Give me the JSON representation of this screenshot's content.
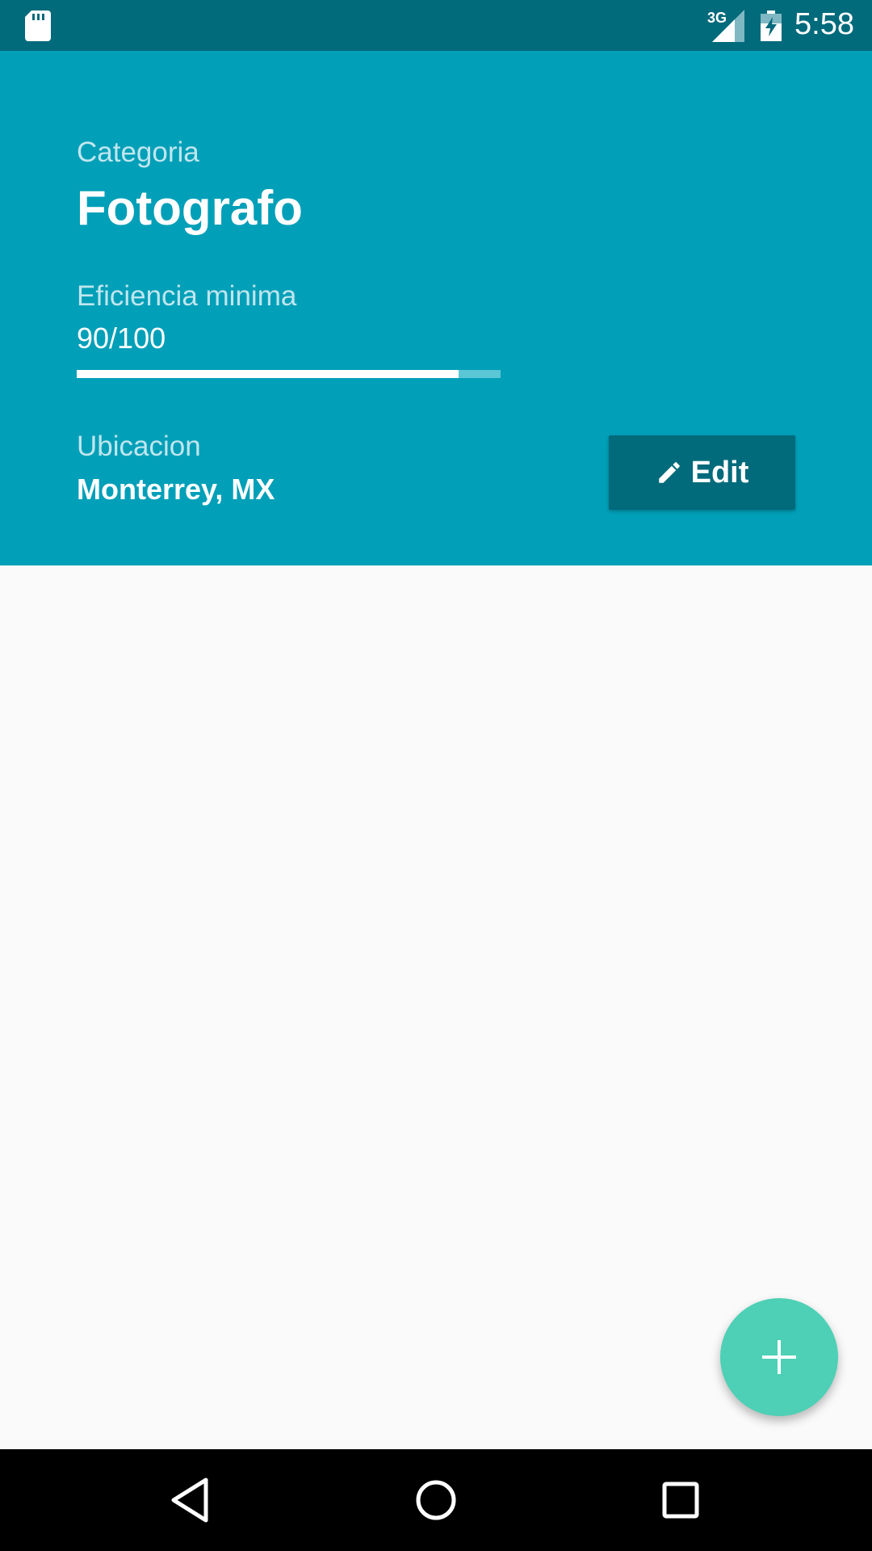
{
  "status_bar": {
    "time": "5:58",
    "network_type": "3G",
    "icons": [
      "sd-card-icon",
      "signal-icon",
      "battery-charging-icon"
    ]
  },
  "header": {
    "category_label": "Categoria",
    "category_value": "Fotografo",
    "efficiency_label": "Eficiencia minima",
    "efficiency_value": "90/100",
    "efficiency_progress": 0.9,
    "location_label": "Ubicacion",
    "location_value": "Monterrey, MX",
    "edit_button_label": "Edit",
    "edit_button_icon": "pencil-icon"
  },
  "fab": {
    "icon": "plus-icon"
  },
  "nav_bar": {
    "icons": [
      "back-icon",
      "home-icon",
      "recents-icon"
    ]
  },
  "colors": {
    "status_bar": "#016a7b",
    "header_bg": "#019fb8",
    "button_bg": "#016a7b",
    "fab_bg": "#4dd0b5",
    "page_bg": "#fafafa"
  }
}
